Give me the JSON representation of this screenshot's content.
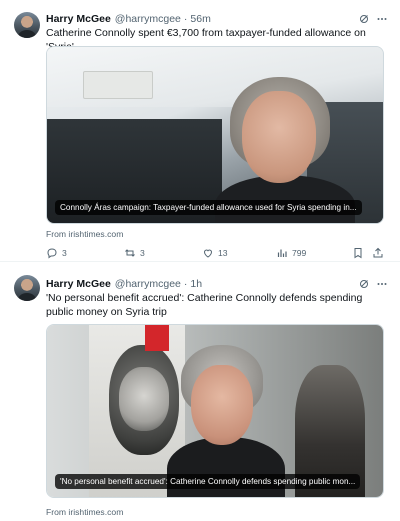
{
  "tweets": [
    {
      "author": {
        "name": "Harry McGee",
        "handle": "@harrymcgee",
        "time": "56m"
      },
      "separator": "·",
      "text": "Catherine Connolly spent €3,700 from taxpayer-funded allowance on 'Syria'",
      "card": {
        "caption": "Connolly Áras campaign: Taxpayer-funded allowance used for Syria spending in...",
        "source": "From irishtimes.com"
      },
      "stats": {
        "replies": "3",
        "reposts": "3",
        "likes": "13",
        "views": "799"
      }
    },
    {
      "author": {
        "name": "Harry McGee",
        "handle": "@harrymcgee",
        "time": "1h"
      },
      "separator": "·",
      "text": "'No personal benefit accrued': Catherine Connolly defends spending public money on Syria trip",
      "card": {
        "caption": "'No personal benefit accrued': Catherine Connolly defends spending public mon...",
        "source": "From irishtimes.com"
      }
    }
  ],
  "icons": {
    "grok": "grok-icon",
    "more": "more-icon",
    "reply": "reply-icon",
    "repost": "repost-icon",
    "like": "heart-icon",
    "views": "views-icon",
    "bookmark": "bookmark-icon",
    "share": "share-icon"
  },
  "colors": {
    "text": "#0f1419",
    "muted": "#536471",
    "border": "#cfd9de"
  }
}
